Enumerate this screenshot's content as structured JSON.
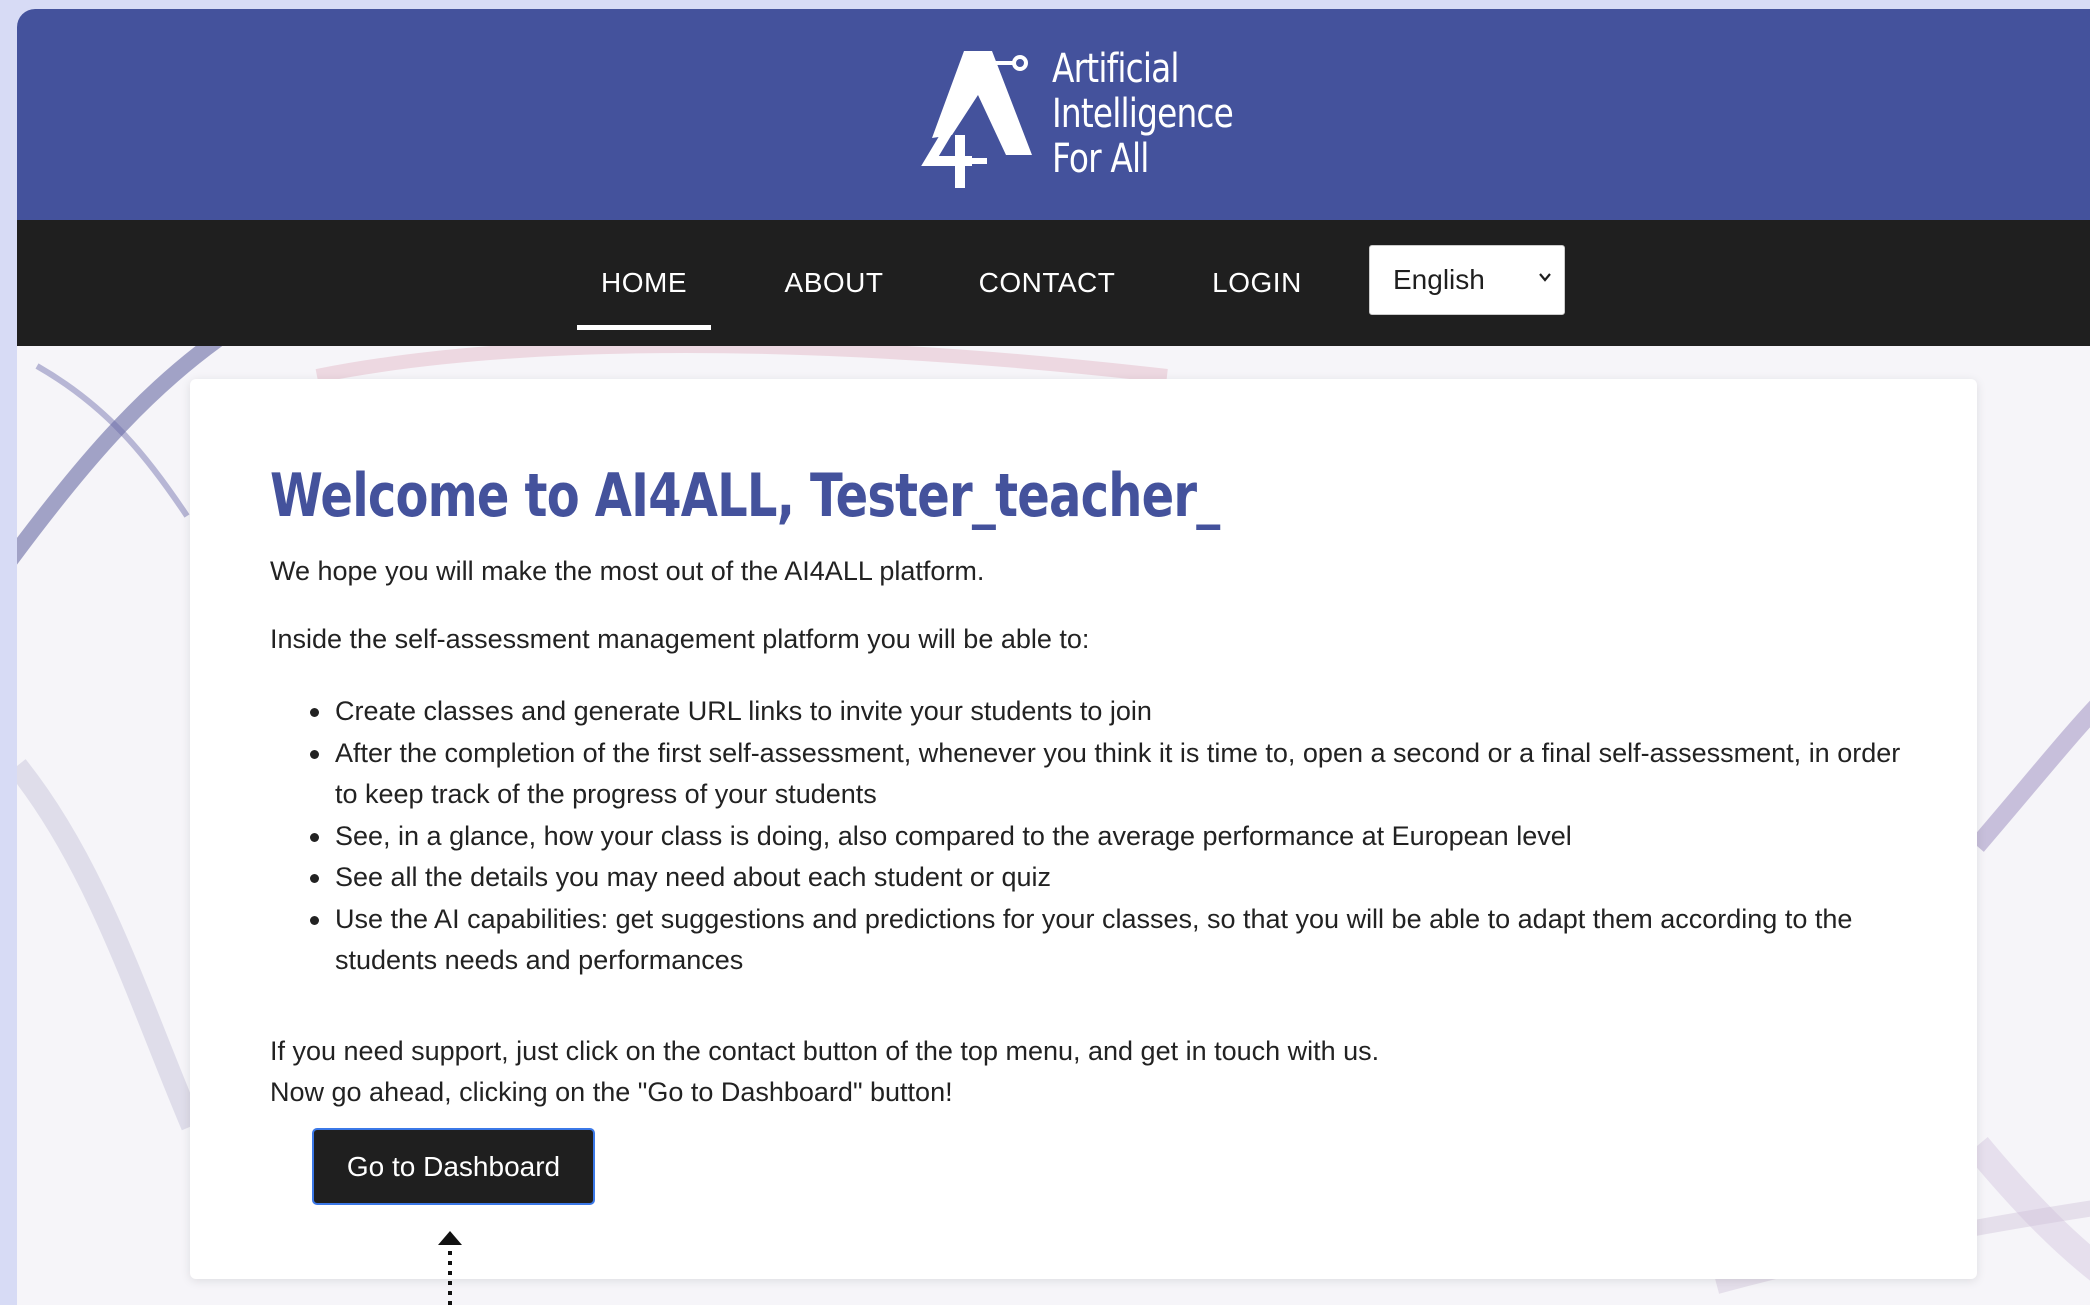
{
  "colors": {
    "header_bg": "#44529c",
    "nav_bg": "#1f1f1f",
    "title_color": "#44529c",
    "button_bg": "#1f1f1f",
    "button_border": "#3b78e7"
  },
  "logo": {
    "icon": "ai4all-logo-icon",
    "lines": [
      "Artificial",
      "Intelligence",
      "For All"
    ]
  },
  "nav": {
    "items": [
      {
        "label": "HOME",
        "active": true
      },
      {
        "label": "ABOUT",
        "active": false
      },
      {
        "label": "CONTACT",
        "active": false
      },
      {
        "label": "LOGIN",
        "active": false
      }
    ],
    "language": {
      "selected": "English",
      "icon": "chevron-down-icon"
    }
  },
  "main": {
    "title": "Welcome to AI4ALL, Tester_teacher_",
    "intro": "We hope you will make the most out of the AI4ALL platform.",
    "lead": "Inside the self-assessment management platform you will be able to:",
    "features": [
      "Create classes and generate URL links to invite your students to join",
      "After the completion of the first self-assessment, whenever you think it is time to, open a second or a final self-assessment, in order to keep track of the progress of your students",
      "See, in a glance, how your class is doing, also compared to the average performance at European level",
      "See all the details you may need about each student or quiz",
      "Use the AI capabilities: get suggestions and predictions for your classes, so that you will be able to adapt them according to the students needs and performances"
    ],
    "support": "If you need support, just click on the contact button of the top menu, and get in touch with us.",
    "cta_text": "Now go ahead, clicking on the \"Go to Dashboard\" button!",
    "button_label": "Go to Dashboard"
  }
}
